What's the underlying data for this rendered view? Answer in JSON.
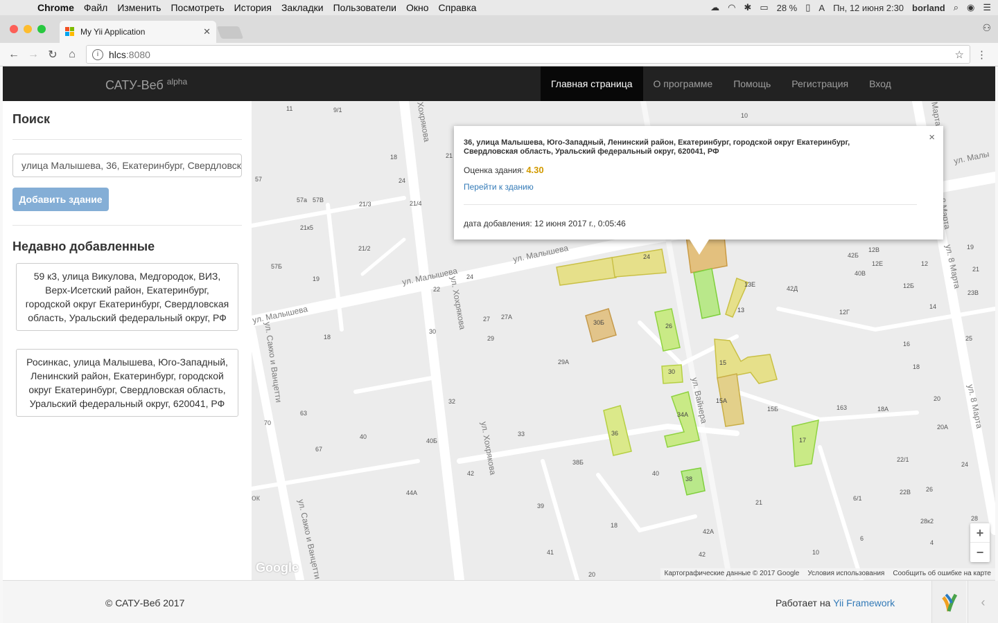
{
  "macos": {
    "menu": [
      "Chrome",
      "Файл",
      "Изменить",
      "Посмотреть",
      "История",
      "Закладки",
      "Пользователи",
      "Окно",
      "Справка"
    ],
    "battery": "28 %",
    "input_lang": "A",
    "clock": "Пн, 12 июня  2:30",
    "user": "borland"
  },
  "browser": {
    "tab_title": "My Yii Application",
    "url_host": "hlcs",
    "url_port": ":8080"
  },
  "navbar": {
    "brand": "САТУ-Веб",
    "brand_sup": "alpha",
    "items": [
      "Главная страница",
      "О программе",
      "Помощь",
      "Регистрация",
      "Вход"
    ]
  },
  "sidebar": {
    "search_title": "Поиск",
    "search_value": "улица Малышева, 36, Екатеринбург, Свердловская область",
    "add_button": "Добавить здание",
    "recent_title": "Недавно добавленные",
    "recent": [
      "59 к3, улица Викулова, Медгородок, ВИЗ, Верх-Исетский район, Екатеринбург, городской округ Екатеринбург, Свердловская область, Уральский федеральный округ, РФ",
      "Росинкас, улица Малышева, Юго-Западный, Ленинский район, Екатеринбург, городской округ Екатеринбург, Свердловская область, Уральский федеральный округ, 620041, РФ"
    ]
  },
  "infowindow": {
    "address": "36, улица Малышева, Юго-Западный, Ленинский район, Екатеринбург, городской округ Екатеринбург, Свердловская область, Уральский федеральный округ, 620041, РФ",
    "rating_label": "Оценка здания:",
    "rating_value": "4.30",
    "goto_link": "Перейти к зданию",
    "date": "дата добавления: 12 июня 2017 г., 0:05:46",
    "close": "×"
  },
  "map": {
    "streets": [
      "ул. Малышева",
      "ул. Малышева",
      "ул. Малышева",
      "ул. Хохрякова",
      "ул. Хохрякова",
      "ул. Вайнера",
      "ул. Сакко и Ванцетти",
      "ул. Сакко и Ванцетти",
      "ул. 8 Марта",
      "ул. 8 Марта",
      "ул. Малы",
      "ул. 8 Марта",
      "Хохрякова",
      "Марта",
      "ок"
    ],
    "house_numbers": [
      "11",
      "9/1",
      "10",
      "18",
      "21",
      "24",
      "57",
      "57а",
      "57В",
      "21/3",
      "21/4",
      "21к5",
      "21/2",
      "57Б",
      "19",
      "22",
      "24",
      "27",
      "27А",
      "30",
      "29",
      "18",
      "29А",
      "32",
      "63",
      "70",
      "40",
      "40Б",
      "67",
      "33",
      "42",
      "38Б",
      "44А",
      "39",
      "18",
      "40",
      "42А",
      "41",
      "42",
      "20",
      "21",
      "10",
      "15Б",
      "163",
      "18А",
      "20",
      "20А",
      "22/1",
      "24",
      "22В",
      "26",
      "28к2",
      "28",
      "6/1",
      "6",
      "4",
      "42Б",
      "12В",
      "12Е",
      "12",
      "19",
      "21",
      "40В",
      "12Б",
      "42Д",
      "14",
      "23В",
      "12Г",
      "25",
      "16",
      "18"
    ],
    "buildings": [
      "24",
      "30Б",
      "26",
      "13Е",
      "13",
      "15",
      "30",
      "15А",
      "34А",
      "36",
      "17",
      "38"
    ],
    "zoom_in": "+",
    "zoom_out": "−",
    "google": "Google",
    "attribution": [
      "Картографические данные © 2017 Google",
      "Условия использования",
      "Сообщить об ошибке на карте"
    ]
  },
  "footer": {
    "copyright": "© САТУ-Веб 2017",
    "powered_prefix": "Работает на",
    "powered_link": "Yii Framework"
  }
}
